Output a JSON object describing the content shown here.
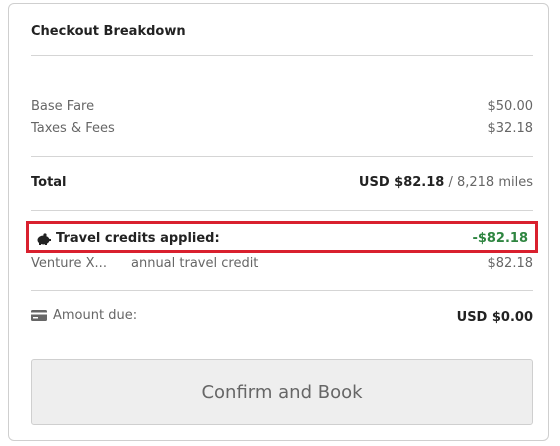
{
  "header": {
    "title": "Checkout Breakdown"
  },
  "fare": {
    "base_label": "Base Fare",
    "base_value": "$50.00",
    "taxes_label": "Taxes & Fees",
    "taxes_value": "$32.18"
  },
  "total": {
    "label": "Total",
    "usd": "USD $82.18",
    "separator": " / ",
    "miles": "8,218 miles"
  },
  "credits": {
    "label": "Travel credits applied:",
    "value": "-$82.18",
    "card_name": "Venture X...",
    "credit_desc": "annual travel credit",
    "credit_value": "$82.18"
  },
  "due": {
    "label": "Amount due:",
    "value": "USD $0.00"
  },
  "actions": {
    "confirm_label": "Confirm and Book"
  },
  "colors": {
    "highlight_border": "#d9202e",
    "credit_green": "#2e8540"
  },
  "icons": {
    "credits": "piggy-bank-icon",
    "due": "credit-card-icon"
  }
}
